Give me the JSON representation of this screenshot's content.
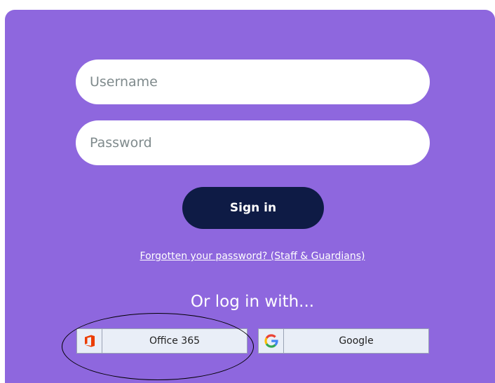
{
  "login": {
    "username_placeholder": "Username",
    "password_placeholder": "Password",
    "signin_label": "Sign in",
    "forgot_link": "Forgotten your password? (Staff & Guardians)",
    "or_login_text": "Or log in with..."
  },
  "sso": {
    "office_label": "Office 365",
    "office_icon": "office-icon",
    "google_label": "Google",
    "google_icon": "google-icon"
  },
  "colors": {
    "panel": "#8e67de",
    "signin_bg": "#0e1b45",
    "sso_bg": "#e9eef7",
    "office_orange": "#eb3c00"
  }
}
